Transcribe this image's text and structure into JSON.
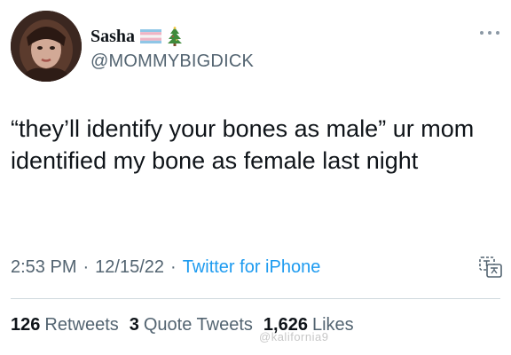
{
  "author": {
    "display_name": "Sasha",
    "handle": "@MOMMYBIGDICK",
    "badges": [
      "transgender-flag-icon",
      "christmas-tree-icon"
    ]
  },
  "tweet": {
    "text": "“they’ll identify your bones as male” ur mom identified my bone as female last night",
    "time": "2:53 PM",
    "separator": "·",
    "date": "12/15/22",
    "source": "Twitter for iPhone"
  },
  "stats": {
    "retweets_count": "126",
    "retweets_label": "Retweets",
    "quotes_count": "3",
    "quotes_label": "Quote Tweets",
    "likes_count": "1,626",
    "likes_label": "Likes"
  },
  "watermark": "@kalifornia9",
  "colors": {
    "text": "#0f1419",
    "secondary": "#536471",
    "link": "#1d9bf0",
    "divider": "#cfd9de"
  }
}
